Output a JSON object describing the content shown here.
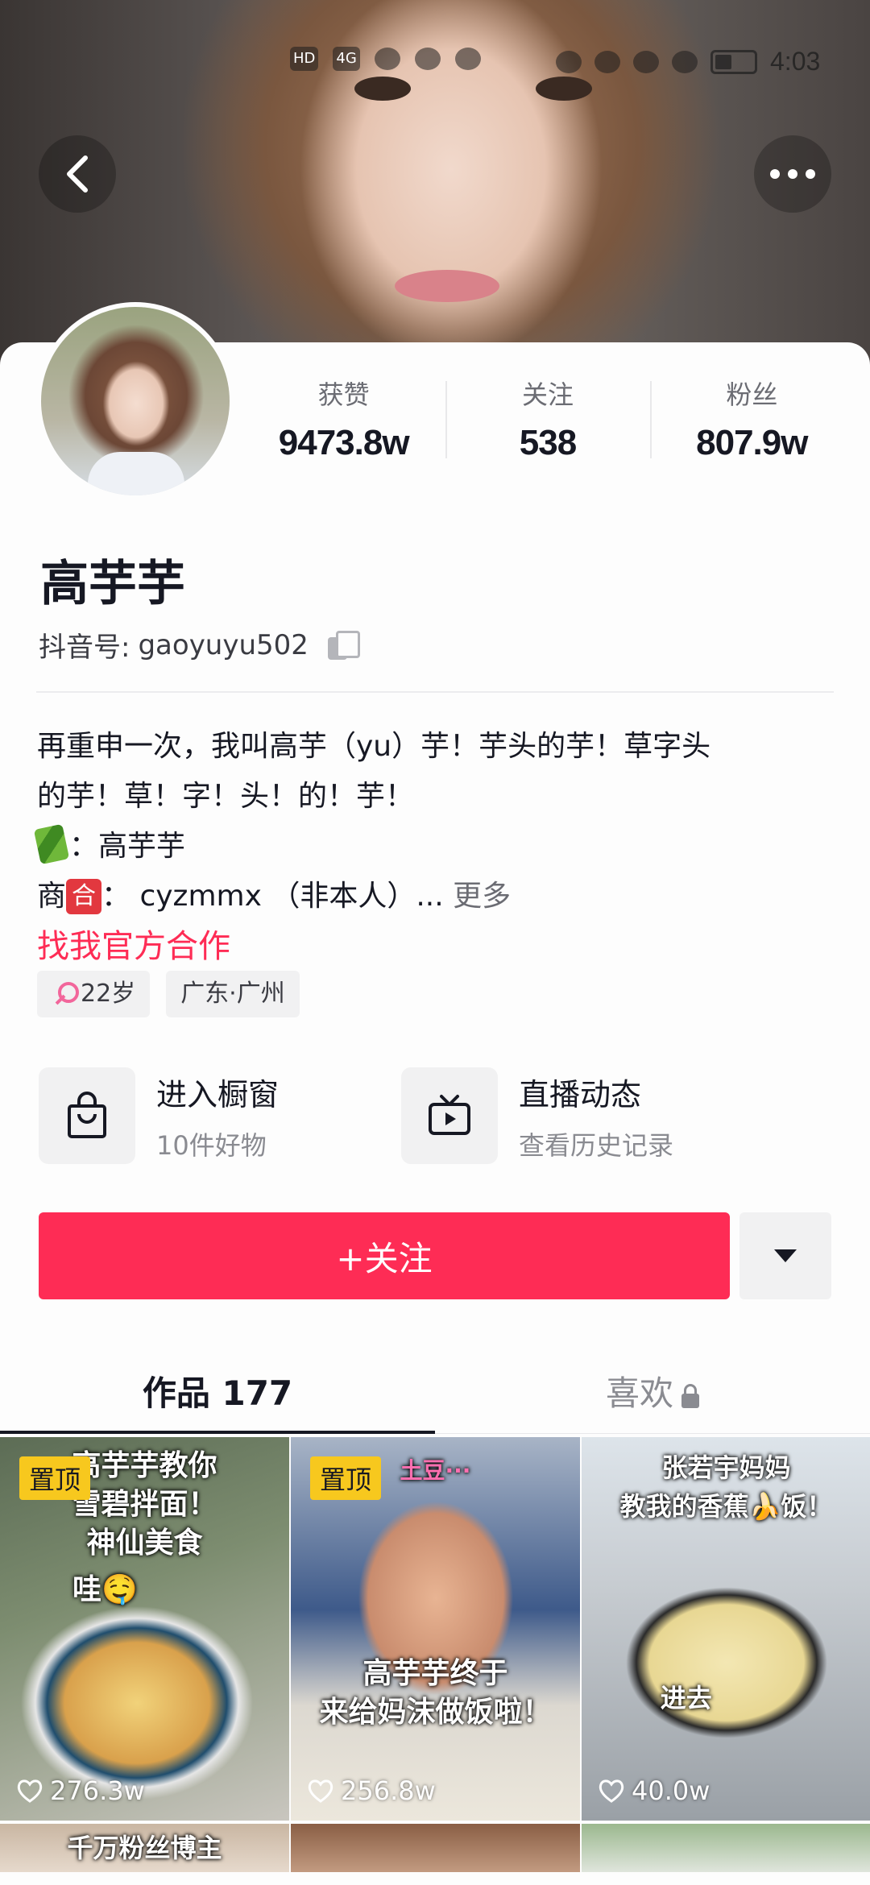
{
  "status_bar": {
    "network_label": "HD",
    "signal_label": "4G",
    "time": "4:03"
  },
  "profile": {
    "stats": [
      {
        "label": "获赞",
        "value": "9473.8w"
      },
      {
        "label": "关注",
        "value": "538"
      },
      {
        "label": "粉丝",
        "value": "807.9w"
      }
    ],
    "name": "高芋芋",
    "handle_prefix": "抖音号:",
    "handle": "gaoyuyu502",
    "bio_lines": [
      "再重申一次，我叫高芋（yu）芋！芋头的芋！草字头",
      "的芋！草！字！头！的！芋！"
    ],
    "bio_weibo_text": "：高芋芋",
    "bio_biz_prefix": "商",
    "bio_biz_badge": "合",
    "bio_biz_text": "： cyzmmx （非本人）...",
    "bio_more": "更多",
    "collab_link": "找我官方合作",
    "tags": {
      "age": "22岁",
      "location": "广东·广州"
    }
  },
  "shortcuts": [
    {
      "title": "进入橱窗",
      "subtitle": "10件好物",
      "icon": "shopping-bag-icon"
    },
    {
      "title": "直播动态",
      "subtitle": "查看历史记录",
      "icon": "tv-live-icon"
    }
  ],
  "actions": {
    "follow_label": "+关注"
  },
  "tabs": {
    "works": "作品 177",
    "likes": "喜欢"
  },
  "videos": [
    {
      "pinned_label": "置顶",
      "caption_lines": [
        "高芋芋教你",
        "雪碧拌面！",
        "神仙美食",
        "哇🤤"
      ],
      "likes": "276.3w"
    },
    {
      "pinned_label": "置顶",
      "caption_lines": [
        "土豆···",
        "高芋芋终于",
        "来给妈沫做饭啦！"
      ],
      "likes": "256.8w"
    },
    {
      "pinned_label": "",
      "caption_lines": [
        "张若宇妈妈",
        "教我的香蕉🍌饭！",
        "进去"
      ],
      "likes": "40.0w"
    },
    {
      "pinned_label": "",
      "caption_lines": [
        "千万粉丝博主"
      ],
      "likes": ""
    },
    {
      "pinned_label": "",
      "caption_lines": [],
      "likes": ""
    },
    {
      "pinned_label": "",
      "caption_lines": [],
      "likes": ""
    }
  ],
  "colors": {
    "accent": "#fe2c55",
    "pin": "#f7c81e",
    "text_primary": "#161823",
    "text_secondary": "#8a8b91"
  }
}
